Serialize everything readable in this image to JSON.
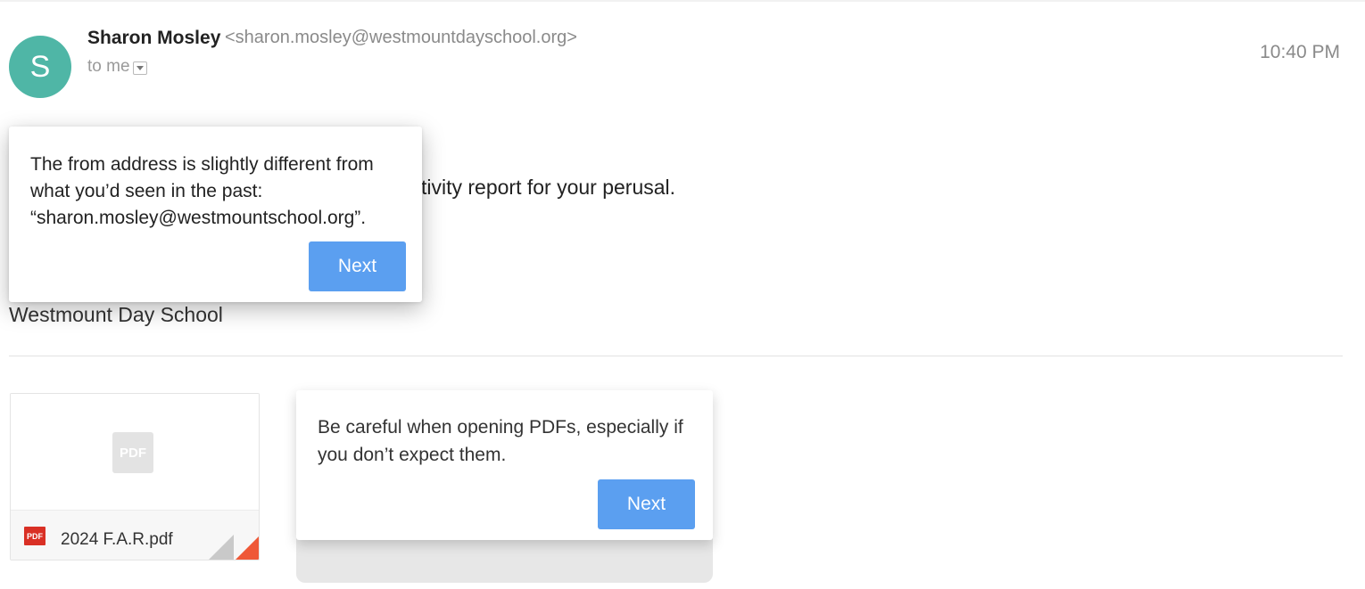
{
  "email": {
    "sender_initial": "S",
    "sender_name": "Sharon Mosley",
    "sender_email": "<sharon.mosley@westmountdayschool.org>",
    "recipient": "to me",
    "time": "10:40 PM",
    "body_visible_fragment": "tivity report for your perusal.",
    "signature": "Westmount Day School"
  },
  "attachment": {
    "placeholder_label": "PDF",
    "file_icon_label": "PDF",
    "file_name": "2024 F.A.R.pdf"
  },
  "tooltips": [
    {
      "message": "The from address is slightly different from what you’d seen in the past: “sharon.mosley@westmountschool.org”.",
      "button_label": "Next"
    },
    {
      "message": "Be careful when opening PDFs, especially if you don’t expect them.",
      "button_label": "Next"
    }
  ],
  "colors": {
    "avatar": "#4fb6a6",
    "next_button": "#5b9ff0",
    "pdf_icon": "#d93025",
    "attachment_corner": "#ef5837"
  }
}
